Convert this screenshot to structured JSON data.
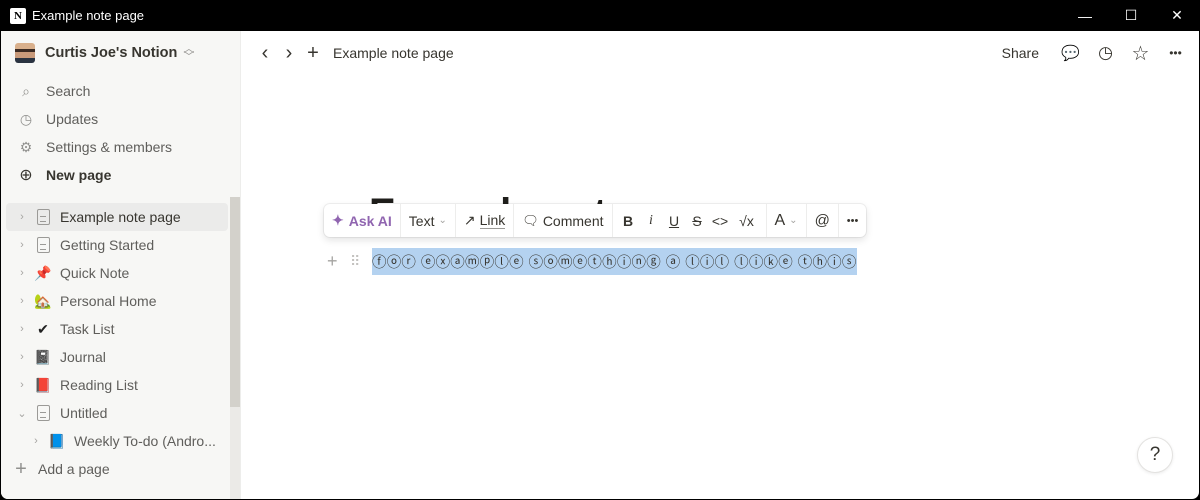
{
  "window": {
    "title": "Example note page",
    "controls": {
      "minimize": "—",
      "maximize": "☐",
      "close": "✕"
    }
  },
  "sidebar": {
    "workspace": "Curtis Joe's Notion",
    "nav": [
      {
        "label": "Search",
        "icon": "search-icon",
        "glyph": "⌕"
      },
      {
        "label": "Updates",
        "icon": "clock-icon",
        "glyph": "◷"
      },
      {
        "label": "Settings & members",
        "icon": "gear-icon",
        "glyph": "⚙"
      },
      {
        "label": "New page",
        "icon": "plus-circle-icon",
        "glyph": "⊕"
      }
    ],
    "pages": [
      {
        "label": "Example note page",
        "icon": "doc",
        "chevron": "›"
      },
      {
        "label": "Getting Started",
        "icon": "doc",
        "chevron": "›"
      },
      {
        "label": "Quick Note",
        "icon": "📌",
        "chevron": "›"
      },
      {
        "label": "Personal Home",
        "icon": "🏡",
        "chevron": "›"
      },
      {
        "label": "Task List",
        "icon": "✔",
        "chevron": "›"
      },
      {
        "label": "Journal",
        "icon": "📓",
        "chevron": "›"
      },
      {
        "label": "Reading List",
        "icon": "📕",
        "chevron": "›"
      },
      {
        "label": "Untitled",
        "icon": "doc",
        "chevron": "⌄"
      },
      {
        "label": "Weekly To-do (Andro...",
        "icon": "📘",
        "chevron": "›"
      }
    ],
    "add_page": "Add a page",
    "add_glyph": "+"
  },
  "topbar": {
    "back": "‹",
    "forward": "›",
    "add": "+",
    "breadcrumb": "Example note page",
    "share": "Share",
    "comment_glyph": "💬",
    "history_glyph": "◷",
    "favorite_glyph": "☆",
    "more_glyph": "•••"
  },
  "page": {
    "title": "Example note page",
    "block_text": "ⓕⓞⓡ ⓔⓧⓐⓜⓟⓛⓔ ⓢⓞⓜⓔⓣⓗⓘⓝⓖ ⓐ ⓛⓘⓛ ⓛⓘⓚⓔ ⓣⓗⓘⓢ",
    "add_block_glyph": "+",
    "drag_glyph": "⠿"
  },
  "toolbar": {
    "ask_ai": "Ask AI",
    "ask_ai_glyph": "✦",
    "text": "Text",
    "caret": "⌄",
    "link_glyph": "↗",
    "link": "Link",
    "comment_glyph": "🗨",
    "comment": "Comment",
    "bold": "B",
    "italic": "i",
    "underline": "U",
    "strike": "S",
    "code": "<>",
    "equation": "√x",
    "color": "A",
    "mention": "@",
    "more": "•••"
  },
  "help": "?"
}
